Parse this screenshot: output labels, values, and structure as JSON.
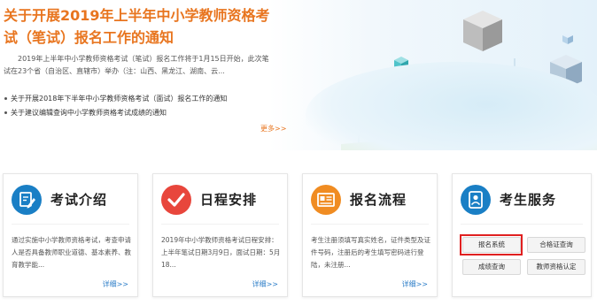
{
  "banner": {
    "headline": "关于开展2019年上半年中小学教师资格考试（笔试）报名工作的通知",
    "summary": "2019年上半年中小学教师资格考试（笔试）报名工作将于1月15日开始，此次笔试在23个省（自治区、直辖市）举办（注：山西、黑龙江、湖南、云...",
    "news": [
      "关于开展2018年下半年中小学教师资格考试（面试）报名工作的通知",
      "关于建议编辑查询中小学教师资格考试成绩的通知"
    ],
    "more": "更多>>"
  },
  "cards": [
    {
      "title": "考试介绍",
      "icon": "edit-document-icon",
      "body": "通过实施中小学教师资格考试，考查申请人是否具备教师职业道德、基本素养、教育教学能...",
      "detail": "详细>>"
    },
    {
      "title": "日程安排",
      "icon": "checkmark-icon",
      "body": "2019年中小学教师资格考试日程安排：上半年笔试日期3月9日，面试日期：5月18...",
      "detail": "详细>>"
    },
    {
      "title": "报名流程",
      "icon": "registration-form-icon",
      "body": "考生注册须填写真实姓名，证件类型及证件号码，注册后的考生填写密码进行登陆，未注册...",
      "detail": "详细>>"
    },
    {
      "title": "考生服务",
      "icon": "id-card-icon",
      "buttons": [
        "报名系统",
        "合格证查询",
        "成绩查询",
        "教师资格认定"
      ]
    }
  ],
  "colors": {
    "accent_orange": "#e8751f",
    "link_blue": "#2a7cc7",
    "highlight_red": "#e02020",
    "icon_blue": "#1a7fc5",
    "icon_red": "#e8463c",
    "icon_orange": "#f08c22"
  }
}
